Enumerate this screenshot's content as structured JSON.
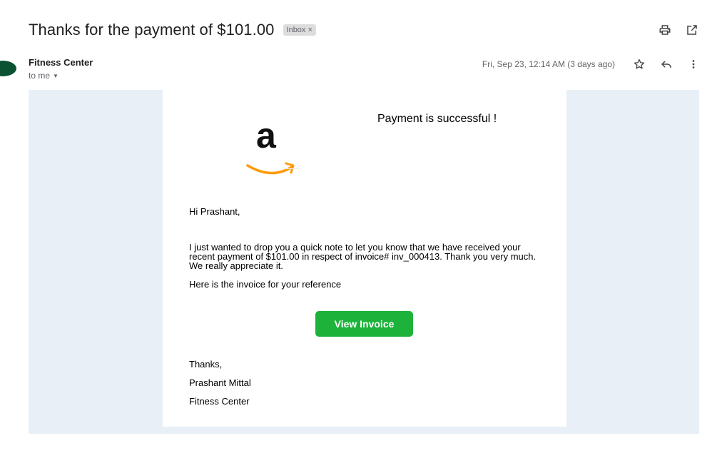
{
  "email": {
    "subject": "Thanks for the payment of $101.00",
    "label": "Inbox",
    "label_close": "×",
    "sender_name": "Fitness Center",
    "recipient": "to me",
    "date": "Fri, Sep 23, 12:14 AM (3 days ago)"
  },
  "icons": {
    "print": "print-icon",
    "open_new_window": "open-in-new-icon",
    "star": "star-icon",
    "reply": "reply-icon",
    "more": "more-vert-icon",
    "dropdown": "arrow-drop-down-icon"
  },
  "message": {
    "logo_letter": "a",
    "heading": "Payment is successful !",
    "greeting": "Hi Prashant,",
    "paragraph": "I just wanted to drop you a quick note to let you know that we have received your recent payment of $101.00 in respect of invoice# inv_000413. Thank you very much. We really appreciate it.",
    "reference_line": "Here is the invoice for your reference",
    "button_label": "View Invoice",
    "signoff": "Thanks,",
    "signature_name": "Prashant Mittal",
    "signature_org": "Fitness Center"
  },
  "colors": {
    "button_bg": "#1db33b",
    "content_background": "#e8eff7",
    "avatar": "#0b5232",
    "logo_smile": "#ff9900"
  }
}
